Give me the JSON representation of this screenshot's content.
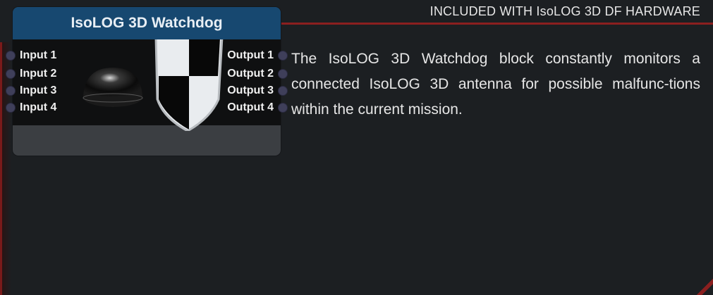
{
  "header": {
    "text": "INCLUDED WITH IsoLOG 3D DF HARDWARE"
  },
  "node": {
    "title": "IsoLOG 3D Watchdog",
    "inputs": [
      "Input 1",
      "Input 2",
      "Input 3",
      "Input 4"
    ],
    "outputs": [
      "Output 1",
      "Output 2",
      "Output 3",
      "Output 4"
    ],
    "graphic_icons": [
      "antenna-dome-icon",
      "shield-icon"
    ]
  },
  "description": "The IsoLOG 3D Watchdog block constantly monitors a connected IsoLOG 3D antenna for possible malfunc-tions within the current mission.",
  "colors": {
    "background": "#1c1f22",
    "node_header": "#174870",
    "accent_red": "#8b1f1f",
    "port": "#3f3f5a"
  }
}
